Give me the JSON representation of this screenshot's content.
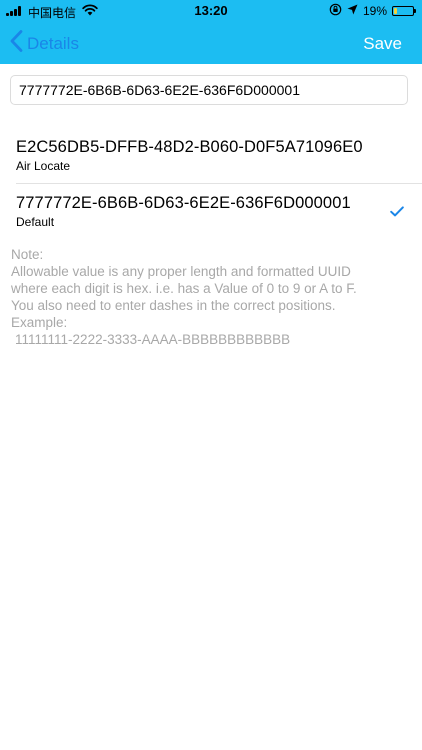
{
  "status_bar": {
    "carrier": "中国电信",
    "time": "13:20",
    "battery_percent": "19%",
    "battery_level": 0.19,
    "battery_color": "#f3d33b"
  },
  "nav": {
    "back_label": "Details",
    "save_label": "Save",
    "bar_color": "#1cbdf2",
    "back_color": "#1a86e8"
  },
  "input": {
    "value": "7777772E-6B6B-6D63-6E2E-636F6D000001"
  },
  "uuid_options": [
    {
      "value": "E2C56DB5-DFFB-48D2-B060-D0F5A71096E0",
      "label": "Air Locate",
      "selected": false
    },
    {
      "value": "7777772E-6B6B-6D63-6E2E-636F6D000001",
      "label": "Default",
      "selected": true
    }
  ],
  "note": {
    "title": "Note:",
    "line1": "Allowable value is any proper length and formatted UUID",
    "line2": "where each digit is hex. i.e. has a Value of 0 to 9 or A to F.",
    "line3": "You also need to enter dashes in the correct positions.",
    "example_label": "Example:",
    "example_value": "11111111-2222-3333-AAAA-BBBBBBBBBBBB"
  },
  "icons": {
    "back": "chevron-left-icon",
    "check": "checkmark-icon",
    "wifi": "wifi-icon",
    "location": "location-arrow-icon",
    "lock": "orientation-lock-icon",
    "battery": "battery-icon",
    "signal": "signal-bars-icon"
  },
  "colors": {
    "checkmark": "#1a86e8",
    "note_text": "#a8a8a8"
  }
}
